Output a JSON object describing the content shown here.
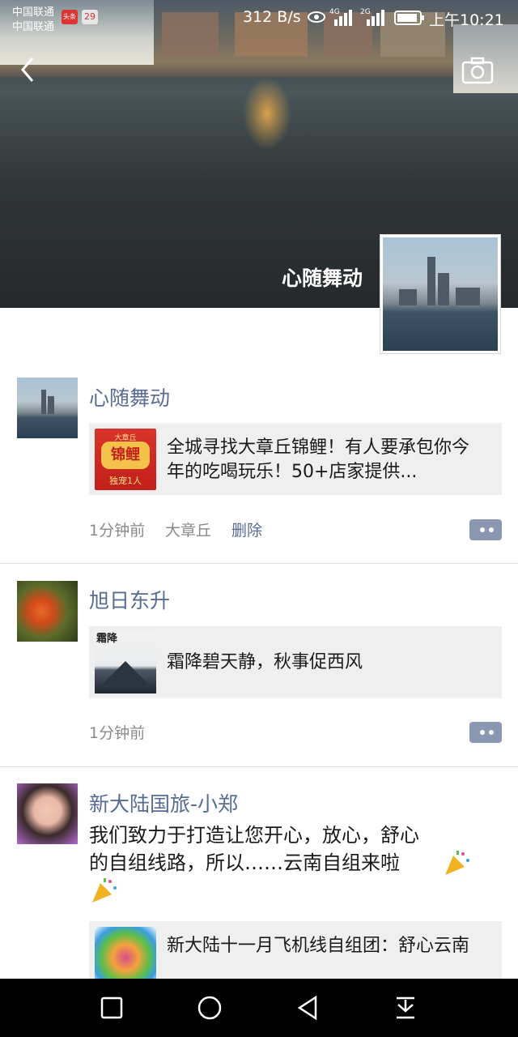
{
  "status_bar": {
    "carrier1": "中国联通",
    "carrier2": "中国联通",
    "notif_badge": "29",
    "app_badge": "头条",
    "net_speed": "312 B/s",
    "time": "上午10:21",
    "signal_2g": "2G",
    "signal_4g": "4G"
  },
  "cover": {
    "nickname": "心随舞动"
  },
  "posts": [
    {
      "name": "心随舞动",
      "card_text": "全城寻找大章丘锦鲤！有人要承包你今年的吃喝玩乐！50+店家提供...",
      "card_thumb_top": "大章丘",
      "card_thumb_main": "锦鲤",
      "card_thumb_bottom": "独宠1人",
      "time": "1分钟前",
      "location": "大章丘",
      "delete": "删除"
    },
    {
      "name": "旭日东升",
      "card_text": "霜降碧天静，秋事促西风",
      "card_thumb_text": "霜降",
      "time": "1分钟前"
    },
    {
      "name": "新大陆国旅-小郑",
      "body_line1": "我们致力于打造让您开心，放心，舒心",
      "body_line2": "的自组线路，所以……云南自组来啦",
      "card_text": "新大陆十一月飞机线自组团：舒心云南"
    }
  ],
  "colors": {
    "link": "#576b95",
    "card_bg": "#efefef",
    "meta": "#8a8a8a"
  }
}
